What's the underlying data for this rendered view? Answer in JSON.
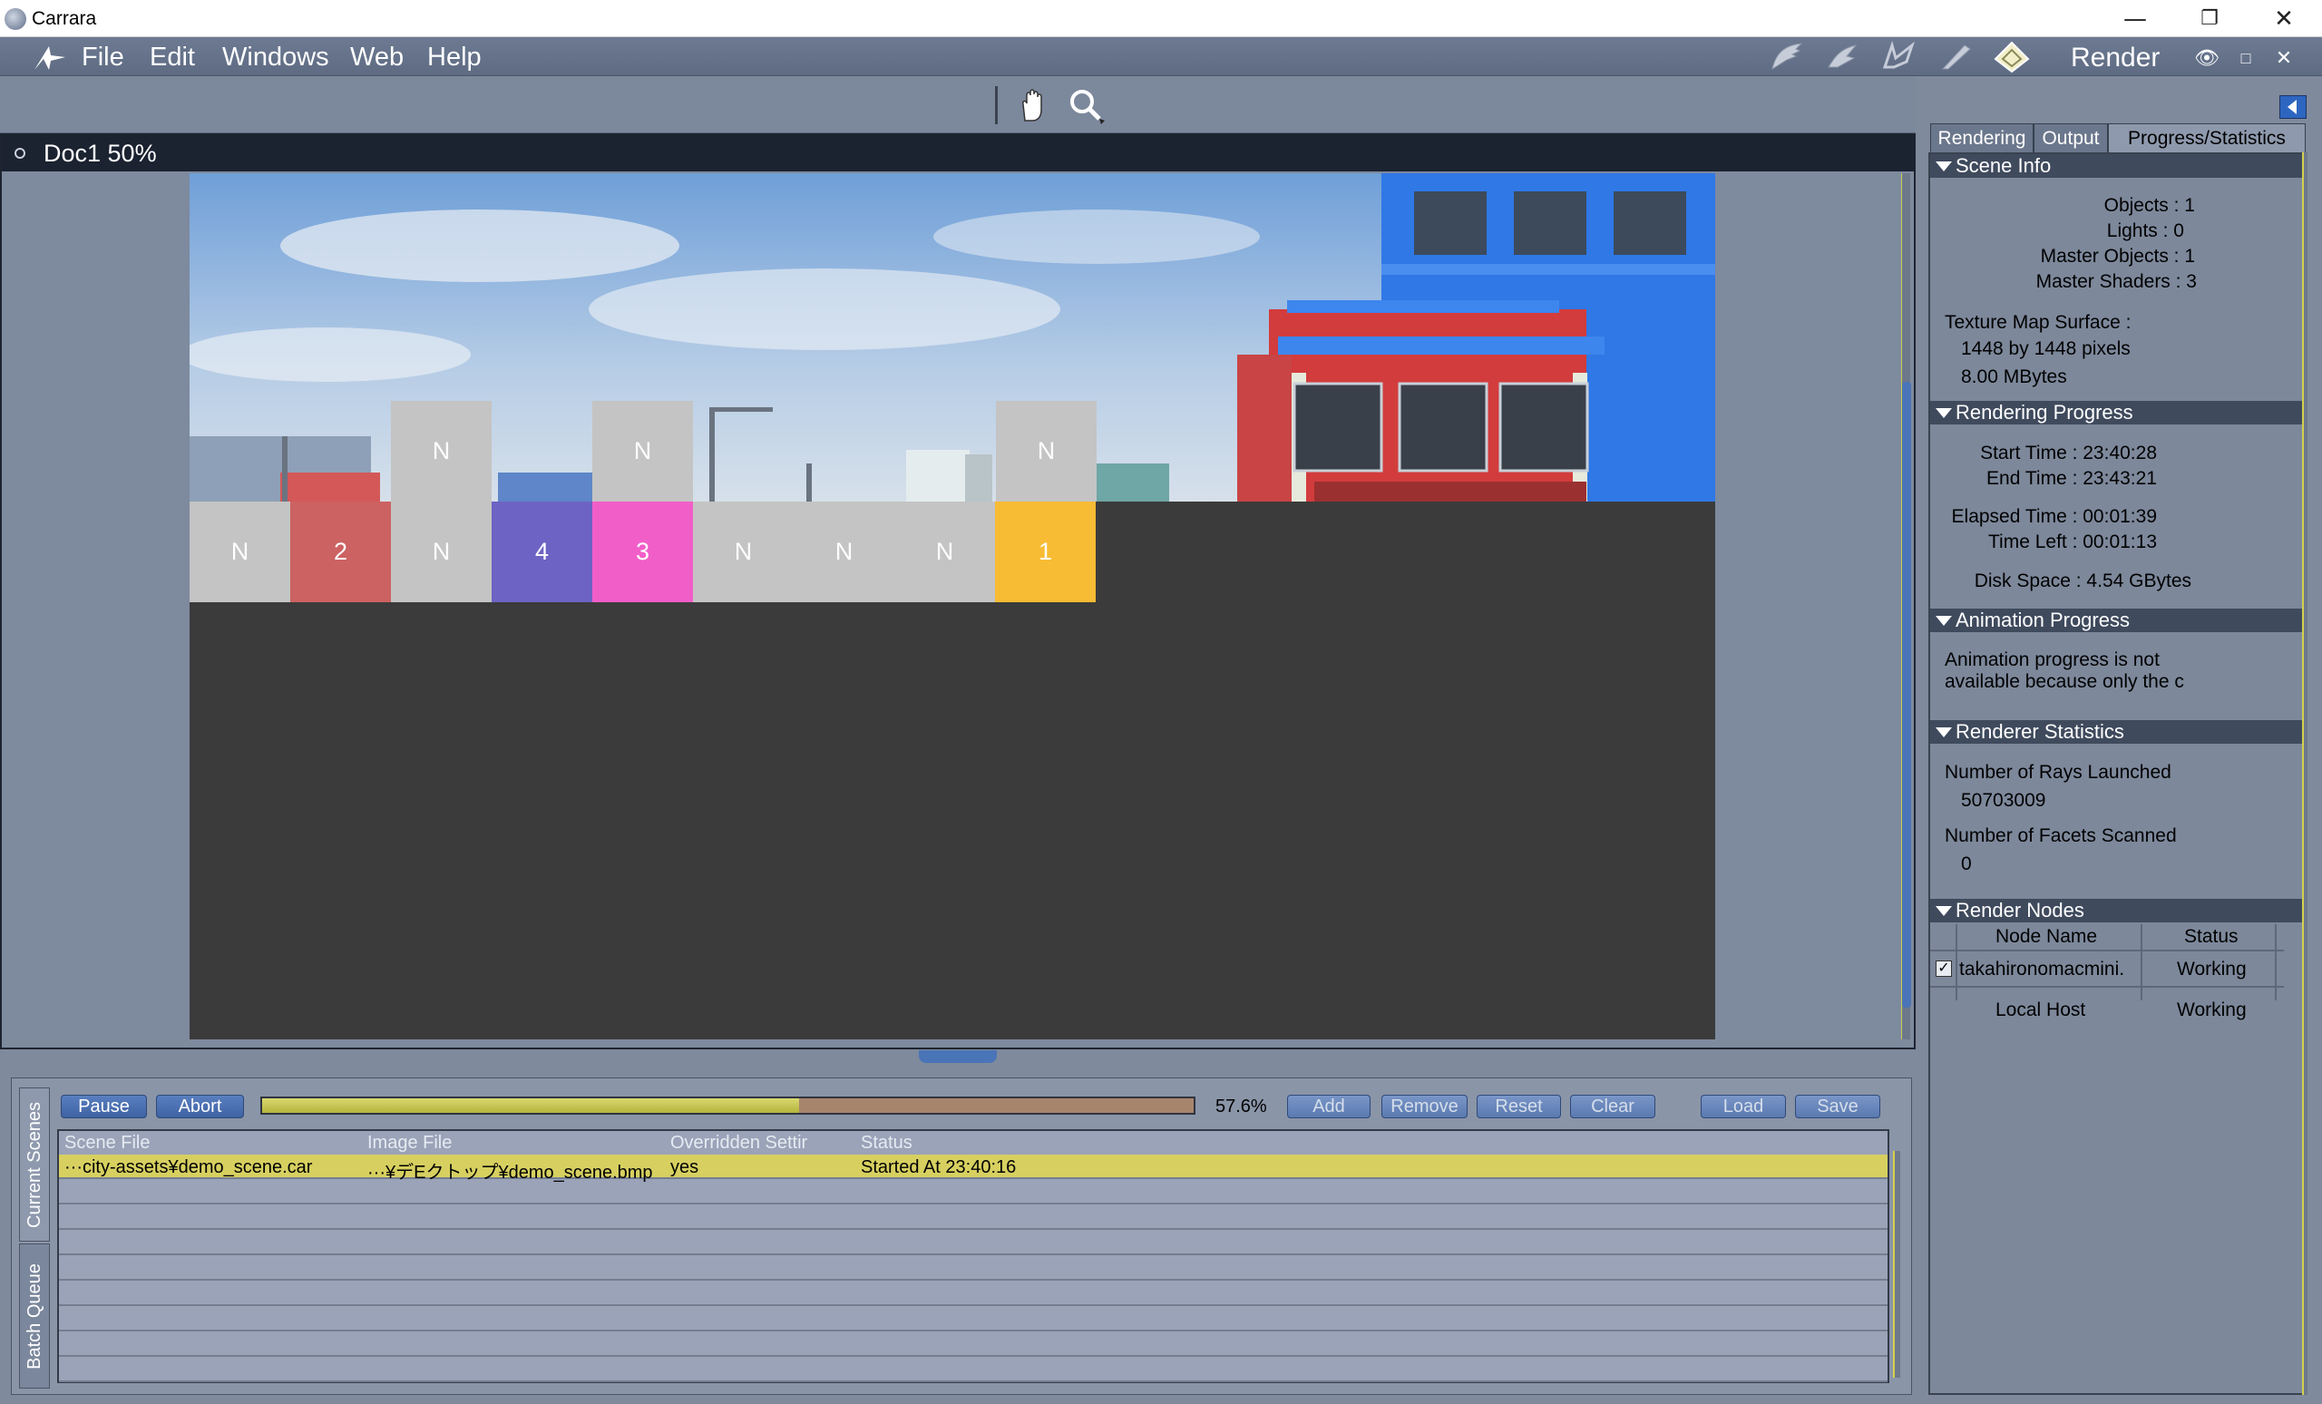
{
  "window": {
    "title": "Carrara"
  },
  "menu": {
    "items": [
      "File",
      "Edit",
      "Windows",
      "Web",
      "Help"
    ],
    "room": "Render"
  },
  "document": {
    "title": "Doc1 50%"
  },
  "tiles": [
    {
      "label": "N",
      "color": "#c4c4c4"
    },
    {
      "label": "2",
      "color": "#cc6262"
    },
    {
      "label": "N",
      "color": "#c4c4c4"
    },
    {
      "label": "4",
      "color": "#6d63c4"
    },
    {
      "label": "3",
      "color": "#f25ec8"
    },
    {
      "label": "N",
      "color": "#c4c4c4"
    },
    {
      "label": "N",
      "color": "#c4c4c4"
    },
    {
      "label": "N",
      "color": "#c4c4c4"
    },
    {
      "label": "1",
      "color": "#f8bb34"
    }
  ],
  "tiles_top": [
    "N",
    "N",
    "N"
  ],
  "batch": {
    "tabs": [
      "Current Scenes",
      "Batch Queue"
    ],
    "pause": "Pause",
    "abort": "Abort",
    "progress": 0.576,
    "progress_label": "57.6%",
    "add": "Add",
    "remove": "Remove",
    "reset": "Reset",
    "clear": "Clear",
    "load": "Load",
    "save": "Save",
    "columns": [
      "Scene File",
      "Image File",
      "Overridden Settir",
      "Status"
    ],
    "rows": [
      {
        "scene": "···city-assets¥demo_scene.car",
        "image": "···¥デEクトップ¥demo_scene.bmp",
        "override": "yes",
        "status": "Started At 23:40:16"
      }
    ]
  },
  "rpanel": {
    "tabs": [
      "Rendering",
      "Output",
      "Progress/Statistics"
    ],
    "scene_info": {
      "title": "Scene Info",
      "objects": "Objects : 1",
      "lights": "Lights : 0",
      "master_objects": "Master Objects : 1",
      "master_shaders": "Master Shaders : 3",
      "texture_label": "Texture Map Surface :",
      "texture_size": "1448 by 1448 pixels",
      "texture_mem": "8.00 MBytes"
    },
    "rendering_progress": {
      "title": "Rendering Progress",
      "start": "Start Time : 23:40:28",
      "end": "End Time : 23:43:21",
      "elapsed": "Elapsed Time : 00:01:39",
      "left": "Time Left : 00:01:13",
      "disk": "Disk Space : 4.54 GBytes"
    },
    "animation_progress": {
      "title": "Animation Progress",
      "line1": "Animation progress is not",
      "line2": "available because only the c"
    },
    "renderer_stats": {
      "title": "Renderer Statistics",
      "rays_label": "Number of Rays Launched",
      "rays_value": "50703009",
      "facets_label": "Number of Facets Scanned",
      "facets_value": "0"
    },
    "render_nodes": {
      "title": "Render Nodes",
      "col_name": "Node Name",
      "col_status": "Status",
      "rows": [
        {
          "name": "takahironomacmini.",
          "status": "Working",
          "checked": true
        },
        {
          "name": "Local Host",
          "status": "Working",
          "checked": false
        }
      ]
    }
  }
}
